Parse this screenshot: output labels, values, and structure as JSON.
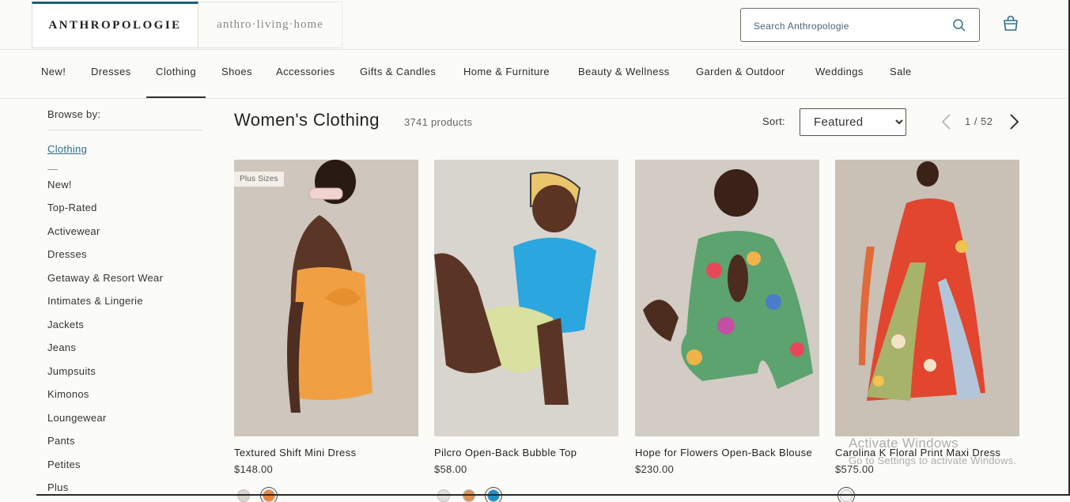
{
  "header": {
    "logo": "ANTHROPOLOGIE",
    "home_logo": "anthro·living·home",
    "search_placeholder": "Search Anthropologie"
  },
  "nav": [
    "New!",
    "Dresses",
    "Clothing",
    "Shoes",
    "Accessories",
    "Gifts & Candles",
    "Home & Furniture",
    "Beauty & Wellness",
    "Garden & Outdoor",
    "Weddings",
    "Sale"
  ],
  "nav_active": "Clothing",
  "sidebar": {
    "browse_label": "Browse by:",
    "current": "Clothing",
    "links": [
      "New!",
      "Top-Rated",
      "Activewear",
      "Dresses",
      "Getaway & Resort Wear",
      "Intimates & Lingerie",
      "Jackets",
      "Jeans",
      "Jumpsuits",
      "Kimonos",
      "Loungewear",
      "Pants",
      "Petites",
      "Plus"
    ]
  },
  "main": {
    "title": "Women's Clothing",
    "count": "3741 products",
    "sort_label": "Sort:",
    "sort_value": "Featured",
    "page": "1 / 52"
  },
  "products": [
    {
      "name": "Textured Shift Mini Dress",
      "price": "$148.00",
      "badge": "Plus Sizes",
      "swatches": [
        "#d9d4cc",
        "#e8873a"
      ],
      "selected_swatch": 1
    },
    {
      "name": "Pilcro Open-Back Bubble Top",
      "price": "$58.00",
      "badge": "",
      "swatches": [
        "#e3e1dc",
        "#d8955a",
        "#1f8fc8"
      ],
      "selected_swatch": 2
    },
    {
      "name": "Hope for Flowers Open-Back Blouse",
      "price": "$230.00",
      "badge": "",
      "swatches": [],
      "selected_swatch": -1
    },
    {
      "name": "Carolina K Floral Print Maxi Dress",
      "price": "$575.00",
      "badge": "",
      "swatches": [
        "#f2f2f2"
      ],
      "selected_swatch": 0
    }
  ],
  "watermark": {
    "line1": "Activate Windows",
    "line2": "Go to Settings to activate Windows."
  },
  "colors": {
    "accent": "#1d5e7a",
    "link": "#2d6f8c"
  }
}
